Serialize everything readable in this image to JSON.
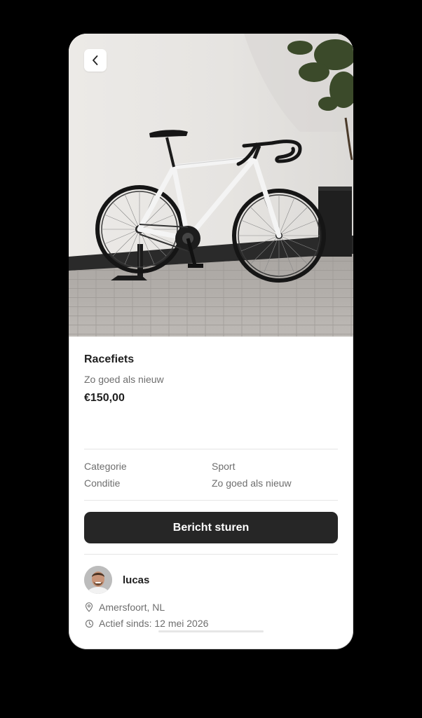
{
  "product": {
    "title": "Racefiets",
    "subtitle": "Zo goed als nieuw",
    "price": "€150,00",
    "image_alt": "road-bike-photo"
  },
  "specs": [
    {
      "label": "Categorie",
      "value": "Sport"
    },
    {
      "label": "Conditie",
      "value": "Zo goed als nieuw"
    }
  ],
  "actions": {
    "message_button": "Bericht sturen"
  },
  "seller": {
    "name": "lucas",
    "location": "Amersfoort, NL",
    "active_since": "Actief sinds: 12 mei 2026"
  },
  "icons": {
    "back": "chevron-left-icon",
    "location": "map-pin-icon",
    "time": "clock-icon"
  },
  "colors": {
    "page_background": "#000000",
    "card_background": "#ffffff",
    "button_background": "#262626",
    "text_primary": "#1f1f1f",
    "text_secondary": "#6e6e6e"
  }
}
